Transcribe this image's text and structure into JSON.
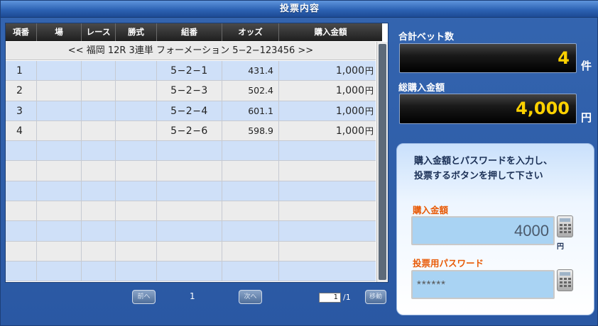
{
  "window": {
    "title": "投票内容"
  },
  "table": {
    "headers": [
      "項番",
      "場",
      "レース",
      "勝式",
      "組番",
      "オッズ",
      "購入金額"
    ],
    "banner": "<< 福岡 12R 3連単 フォーメーション 5−2−123456 >>",
    "rows": [
      {
        "idx": "1",
        "combo": "5−2−1",
        "odds": "431.4",
        "amount": "1,000",
        "unit": "円"
      },
      {
        "idx": "2",
        "combo": "5−2−3",
        "odds": "502.4",
        "amount": "1,000",
        "unit": "円"
      },
      {
        "idx": "3",
        "combo": "5−2−4",
        "odds": "601.1",
        "amount": "1,000",
        "unit": "円"
      },
      {
        "idx": "4",
        "combo": "5−2−6",
        "odds": "598.9",
        "amount": "1,000",
        "unit": "円"
      }
    ]
  },
  "pager": {
    "prev": "前へ",
    "page": "1",
    "next": "次へ",
    "page_input": "1",
    "page_total": "/1",
    "move": "移動"
  },
  "summary": {
    "bets_label": "合計ベット数",
    "bets_value": "4",
    "bets_unit": "件",
    "total_label": "総購入金額",
    "total_value": "4,000",
    "total_unit": "円"
  },
  "form": {
    "message_line1": "購入金額とパスワードを入力し、",
    "message_line2": "投票するボタンを押して下さい",
    "amount_label": "購入金額",
    "amount_value": "4000",
    "amount_unit": "円",
    "password_label": "投票用パスワード",
    "password_value": "******"
  }
}
